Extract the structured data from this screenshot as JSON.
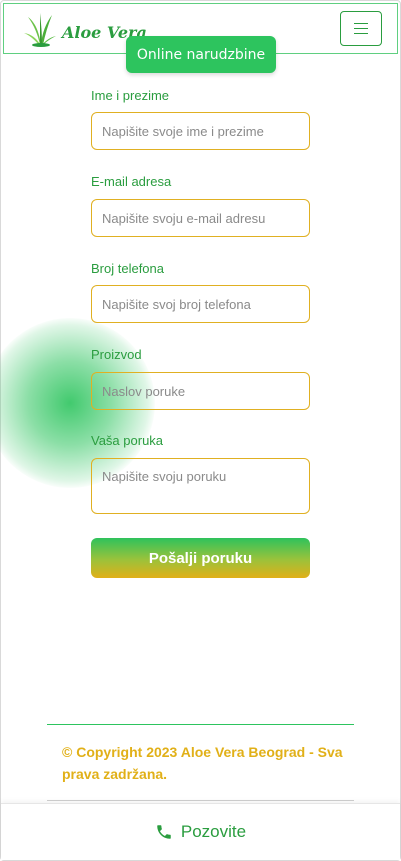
{
  "header": {
    "brand_text": "Aloe Vera",
    "logo_icon": "aloe-plant-icon",
    "menu_icon": "hamburger-icon"
  },
  "badge": {
    "label": "Online narudzbine"
  },
  "form": {
    "fields": [
      {
        "label": "Ime i prezime",
        "placeholder": "Napišite svoje ime i prezime",
        "value": ""
      },
      {
        "label": "E-mail adresa",
        "placeholder": "Napišite svoju e-mail adresu",
        "value": ""
      },
      {
        "label": "Broj telefona",
        "placeholder": "Napišite svoj broj telefona",
        "value": ""
      },
      {
        "label": "Proizvod",
        "placeholder": "Naslov poruke",
        "value": ""
      },
      {
        "label": "Vaša poruka",
        "placeholder": "Napišite svoju poruku",
        "value": ""
      }
    ],
    "submit_label": "Pošalji poruku"
  },
  "footer": {
    "copyright": "© Copyright 2023 Aloe Vera Beograd - Sva prava zadržana."
  },
  "call_bar": {
    "label": "Pozovite",
    "icon": "phone-icon"
  },
  "colors": {
    "green": "#2dc45e",
    "dark_green": "#2a9d3f",
    "gold": "#e1b018"
  }
}
